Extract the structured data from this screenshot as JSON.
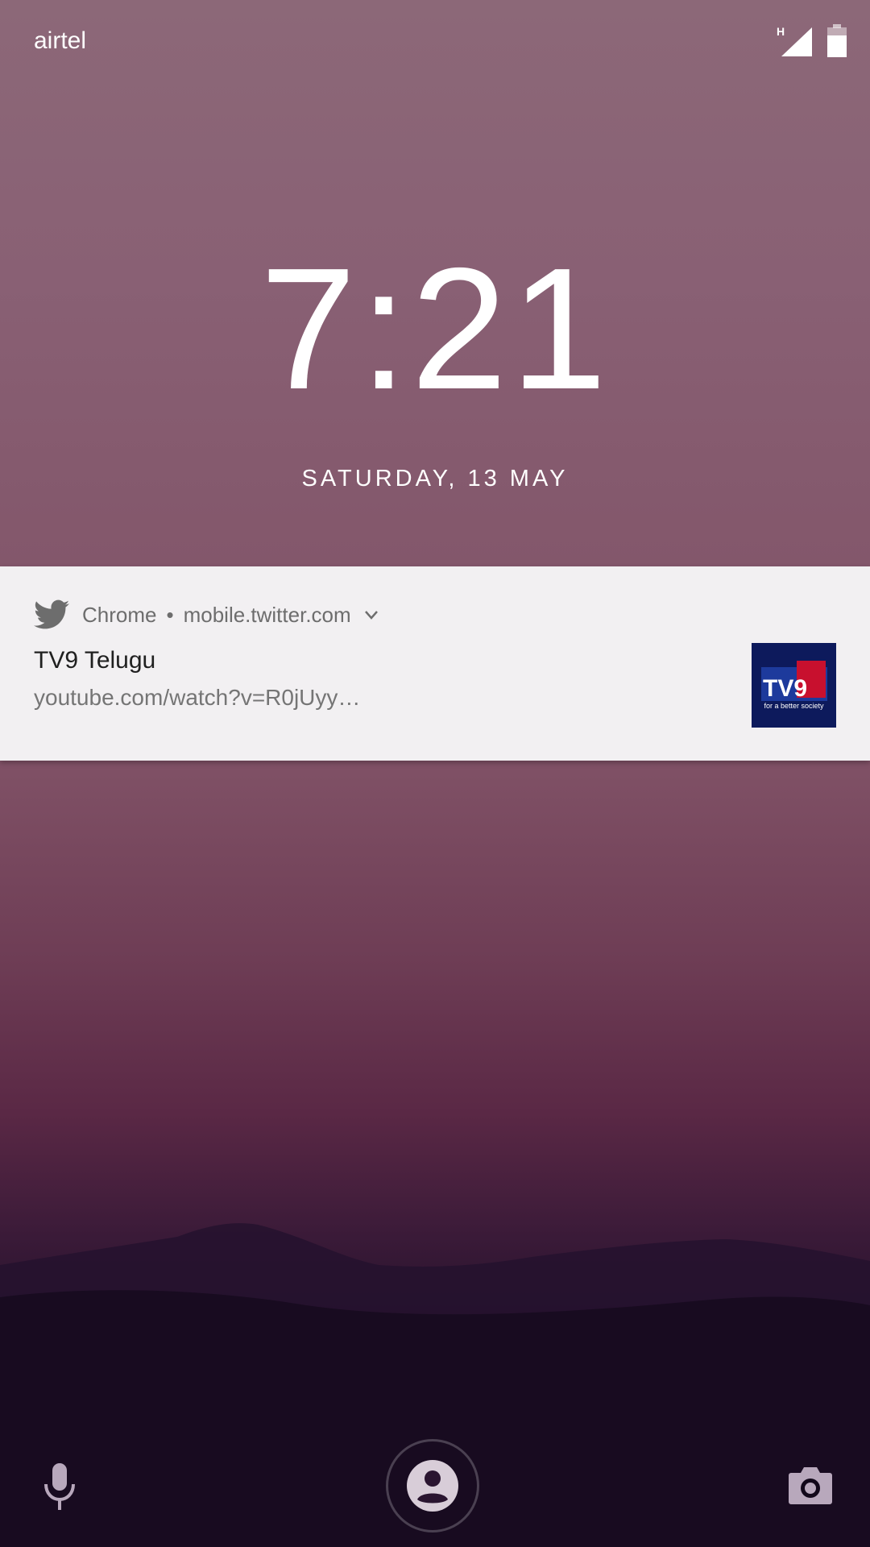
{
  "status_bar": {
    "carrier": "airtel",
    "network_type": "H",
    "signal_icon": "signal-icon",
    "battery_icon": "battery-icon"
  },
  "lockscreen": {
    "time": "7:21",
    "date": "SATURDAY, 13 MAY"
  },
  "notification": {
    "app_icon": "twitter-icon",
    "app_name": "Chrome",
    "separator": "•",
    "source": "mobile.twitter.com",
    "expand_icon": "chevron-down-icon",
    "title": "TV9 Telugu",
    "text": "youtube.com/watch?v=R0jUyy…",
    "thumbnail": {
      "logo_text": "TV9",
      "tagline": "for a better society"
    }
  },
  "bottom_bar": {
    "left_icon": "microphone-icon",
    "center_icon": "user-icon",
    "right_icon": "camera-icon"
  },
  "colors": {
    "text_primary": "#ffffff",
    "notification_bg": "#f2f0f2",
    "thumb_bg": "#0d1a5c",
    "thumb_accent": "#c8102e"
  }
}
